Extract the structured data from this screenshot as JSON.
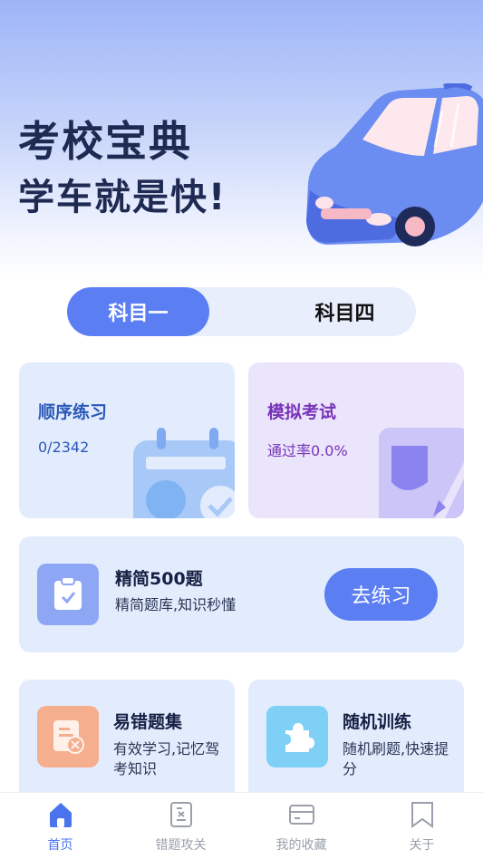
{
  "hero": {
    "title": "考校宝典",
    "subtitle": "学车就是快!"
  },
  "subjects": {
    "tabs": [
      "科目一",
      "科目四"
    ],
    "selected": "科目一"
  },
  "cards": {
    "sequence": {
      "title": "顺序练习",
      "progress": "0/2342",
      "icon": "calendar-icon"
    },
    "mock": {
      "title": "模拟考试",
      "pass_rate": "通过率0.0%",
      "icon": "pencil-icon"
    },
    "concise": {
      "title": "精简500题",
      "desc": "精简题库,知识秒懂",
      "button": "去练习",
      "icon": "clipboard-check-icon"
    },
    "mistakes": {
      "title": "易错题集",
      "desc": "有效学习,记忆驾考知识",
      "icon": "document-x-icon"
    },
    "random": {
      "title": "随机训练",
      "desc": "随机刷题,快速提分",
      "icon": "puzzle-icon"
    }
  },
  "tabbar": {
    "items": [
      {
        "label": "首页",
        "icon": "home-icon",
        "active": true
      },
      {
        "label": "错题攻关",
        "icon": "error-note-icon",
        "active": false
      },
      {
        "label": "我的收藏",
        "icon": "card-icon",
        "active": false
      },
      {
        "label": "关于",
        "icon": "bookmark-icon",
        "active": false
      }
    ]
  },
  "colors": {
    "accent": "#5b7ef3",
    "sequence_text": "#2b59b8",
    "mock_text": "#7734b8"
  }
}
